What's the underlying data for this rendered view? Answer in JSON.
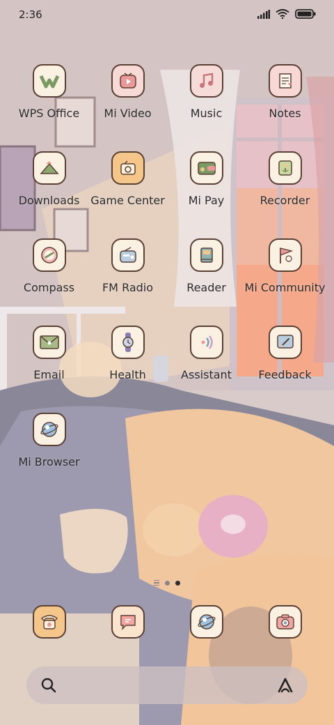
{
  "status": {
    "time": "2:36"
  },
  "apps": [
    {
      "label": "WPS Office",
      "icon": "wps-office-icon"
    },
    {
      "label": "Mi Video",
      "icon": "mi-video-icon"
    },
    {
      "label": "Music",
      "icon": "music-icon"
    },
    {
      "label": "Notes",
      "icon": "notes-icon"
    },
    {
      "label": "Downloads",
      "icon": "downloads-icon"
    },
    {
      "label": "Game Center",
      "icon": "game-center-icon"
    },
    {
      "label": "Mi Pay",
      "icon": "mi-pay-icon"
    },
    {
      "label": "Recorder",
      "icon": "recorder-icon"
    },
    {
      "label": "Compass",
      "icon": "compass-icon"
    },
    {
      "label": "FM Radio",
      "icon": "fm-radio-icon"
    },
    {
      "label": "Reader",
      "icon": "reader-icon"
    },
    {
      "label": "Mi Community",
      "icon": "mi-community-icon"
    },
    {
      "label": "Email",
      "icon": "email-icon"
    },
    {
      "label": "Health",
      "icon": "health-icon"
    },
    {
      "label": "Assistant",
      "icon": "assistant-icon"
    },
    {
      "label": "Feedback",
      "icon": "feedback-icon"
    },
    {
      "label": "Mi Browser",
      "icon": "mi-browser-icon"
    }
  ],
  "dock": [
    {
      "icon": "phone-icon"
    },
    {
      "icon": "messages-icon"
    },
    {
      "icon": "browser-icon"
    },
    {
      "icon": "camera-icon"
    }
  ],
  "page_indicator": {
    "pages": 2,
    "current": 2
  },
  "colors": {
    "icon_bg": "#fbf1e3",
    "icon_border": "#5a3f34",
    "search_bg": "#cdc0c2"
  }
}
